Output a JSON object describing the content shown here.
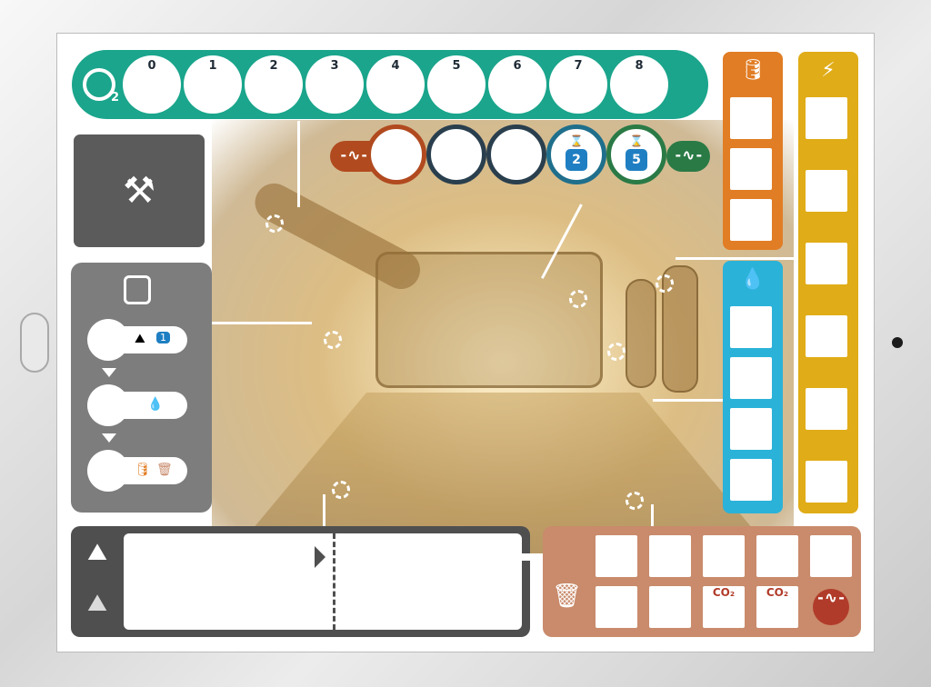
{
  "oxygen_track": {
    "icon": "o2-icon",
    "icon_label": "2",
    "slots": [
      "0",
      "1",
      "2",
      "3",
      "4",
      "5",
      "6",
      "7",
      "8"
    ],
    "color": "#1aa58c"
  },
  "health_track": {
    "slot_colors": [
      "#b14a1f",
      "#2a3f4e",
      "#2a3f4e",
      "#1f6f8c",
      "#2a7a46"
    ],
    "left_color": "#b14a1f",
    "right_color": "#2a7a46",
    "timer_slots": [
      {
        "hourglass": "⌛",
        "value": "2"
      },
      {
        "hourglass": "⌛",
        "value": "5"
      }
    ],
    "pulse_glyph": "-∿-"
  },
  "tools_panel": {
    "icon": "hammer-wrench-icon",
    "glyph": "⚒"
  },
  "process_panel": {
    "rows": [
      {
        "icons": [
          "⛰",
          "1"
        ]
      },
      {
        "icons": [
          "💧"
        ]
      },
      {
        "icons": [
          "🛢",
          "🗑"
        ]
      }
    ]
  },
  "gas_column": {
    "icon": "gas-canister-icon",
    "glyph": "🛢",
    "color": "#e17d24",
    "boxes": 3
  },
  "water_column": {
    "icon": "water-drops-icon",
    "glyph": "💧",
    "color": "#2bb2d8",
    "boxes": 4
  },
  "energy_column": {
    "icon": "energy-bolt-icon",
    "glyph": "⚡",
    "color": "#e0ac17",
    "boxes": 6
  },
  "minerals_panel": {
    "top_icon": "⛰",
    "bottom_icon": "⛰"
  },
  "output_panel": {
    "trash_glyph": "🗑",
    "co2_label": "CO₂",
    "vital_glyph": "-∿-",
    "color": "#c98b6c"
  }
}
